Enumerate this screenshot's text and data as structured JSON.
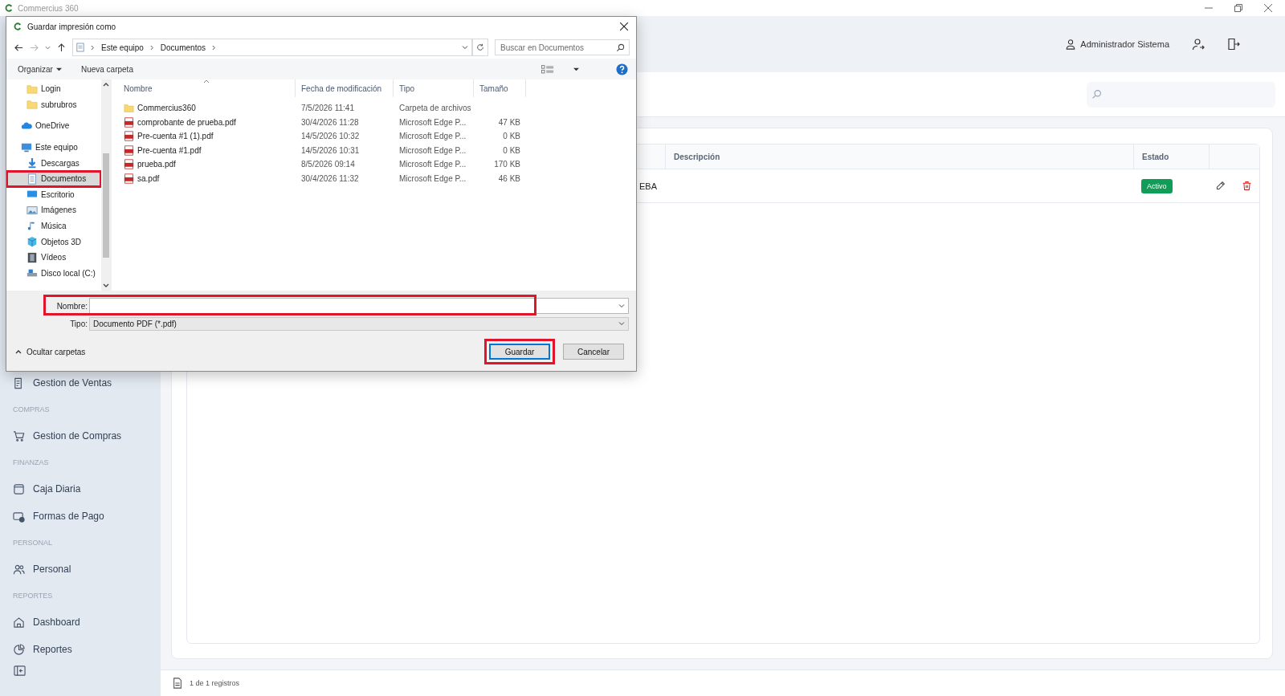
{
  "app": {
    "title": "Commercius 360",
    "user": "Administrador Sistema",
    "sidebar": [
      {
        "kind": "item",
        "label": "Gestion de Ventas"
      },
      {
        "kind": "section",
        "label": "COMPRAS"
      },
      {
        "kind": "item",
        "label": "Gestion de Compras"
      },
      {
        "kind": "section",
        "label": "FINANZAS"
      },
      {
        "kind": "item",
        "label": "Caja Diaria"
      },
      {
        "kind": "item",
        "label": "Formas de Pago"
      },
      {
        "kind": "section",
        "label": "PERSONAL"
      },
      {
        "kind": "item",
        "label": "Personal"
      },
      {
        "kind": "section",
        "label": "REPORTES"
      },
      {
        "kind": "item",
        "label": "Dashboard"
      },
      {
        "kind": "item",
        "label": "Reportes"
      }
    ],
    "table": {
      "columns": [
        "Descripción",
        "Estado"
      ],
      "rows": [
        {
          "column_1": "EBA",
          "status": "Activo"
        }
      ]
    },
    "footer": "1 de 1 registros"
  },
  "dialog": {
    "title": "Guardar impresión como",
    "path": [
      "Este equipo",
      "Documentos"
    ],
    "search": {
      "placeholder": "Buscar en Documentos"
    },
    "toolbar": [
      "Organizar",
      "Nueva carpeta"
    ],
    "nav": [
      {
        "kind": "folder",
        "label": "Login",
        "selected": false,
        "highlighted": false
      },
      {
        "kind": "folder",
        "label": "subrubros",
        "selected": false,
        "highlighted": false
      },
      {
        "kind": "cloud",
        "label": "OneDrive",
        "selected": false,
        "highlighted": false
      },
      {
        "kind": "computer",
        "label": "Este equipo",
        "selected": false,
        "highlighted": false,
        "children": [
          {
            "kind": "download",
            "label": "Descargas",
            "selected": false,
            "highlighted": false
          },
          {
            "kind": "documents",
            "label": "Documentos",
            "selected": true,
            "highlighted": true
          },
          {
            "kind": "desktop",
            "label": "Escritorio",
            "selected": false,
            "highlighted": false
          },
          {
            "kind": "pictures",
            "label": "Imágenes",
            "selected": false,
            "highlighted": false
          },
          {
            "kind": "music",
            "label": "Música",
            "selected": false,
            "highlighted": false
          },
          {
            "kind": "cube",
            "label": "Objetos 3D",
            "selected": false,
            "highlighted": false
          },
          {
            "kind": "video",
            "label": "Vídeos",
            "selected": false,
            "highlighted": false
          },
          {
            "kind": "drive",
            "label": "Disco local (C:)",
            "selected": false,
            "highlighted": false
          }
        ]
      }
    ],
    "columns": [
      "Nombre",
      "Fecha de modificación",
      "Tipo",
      "Tamaño"
    ],
    "files": [
      {
        "kind": "folder",
        "name": "Commercius360",
        "modified": "7/5/2026 11:41",
        "type": "Carpeta de archivos"
      },
      {
        "kind": "pdf",
        "name": "comprobante de prueba.pdf",
        "modified": "30/4/2026 11:28",
        "type": "Microsoft Edge P...",
        "size": "47 KB"
      },
      {
        "kind": "pdf",
        "name": "Pre-cuenta #1 (1).pdf",
        "modified": "14/5/2026 10:32",
        "type": "Microsoft Edge P...",
        "size": "0 KB"
      },
      {
        "kind": "pdf",
        "name": "Pre-cuenta #1.pdf",
        "modified": "14/5/2026 10:31",
        "type": "Microsoft Edge P...",
        "size": "0 KB"
      },
      {
        "kind": "pdf",
        "name": "prueba.pdf",
        "modified": "8/5/2026 09:14",
        "type": "Microsoft Edge P...",
        "size": "170 KB"
      },
      {
        "kind": "pdf",
        "name": "sa.pdf",
        "modified": "30/4/2026 11:32",
        "type": "Microsoft Edge P...",
        "size": "46 KB"
      }
    ],
    "name_field": {
      "label": "Nombre:",
      "highlighted": true
    },
    "type_field": {
      "label": "Tipo:",
      "value": "Documento PDF (*.pdf)"
    },
    "hide_folders": "Ocultar carpetas",
    "buttons": [
      {
        "label": "Guardar",
        "default": true,
        "highlighted": true
      },
      {
        "label": "Cancelar",
        "default": false,
        "highlighted": false
      }
    ]
  }
}
